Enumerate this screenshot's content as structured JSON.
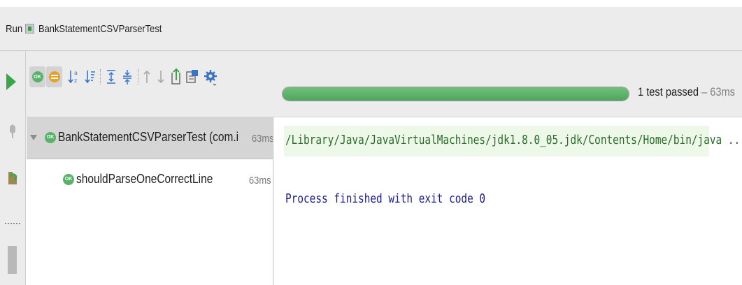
{
  "window": {
    "run_label": "Run",
    "config_name": "BankStatementCSVParserTest"
  },
  "toolbar": {
    "ok_badge": "OK",
    "progress": 1.0,
    "status_text": "1 test passed",
    "status_separator": " – ",
    "status_duration": "63ms"
  },
  "tree": {
    "suite": {
      "label": "BankStatementCSVParserTest (com.i",
      "time": "63ms",
      "badge": "OK"
    },
    "test": {
      "label": "shouldParseOneCorrectLine",
      "time": "63ms",
      "badge": "OK"
    }
  },
  "console": {
    "command_line": "/Library/Java/JavaVirtualMachines/jdk1.8.0_05.jdk/Contents/Home/bin/java ...",
    "finish_line": "Process finished with exit code 0"
  },
  "colors": {
    "pass_green": "#58b368",
    "progress_green": "#4ea65c",
    "console_command": "#2a6b2a",
    "console_output": "#1a1a8c"
  }
}
